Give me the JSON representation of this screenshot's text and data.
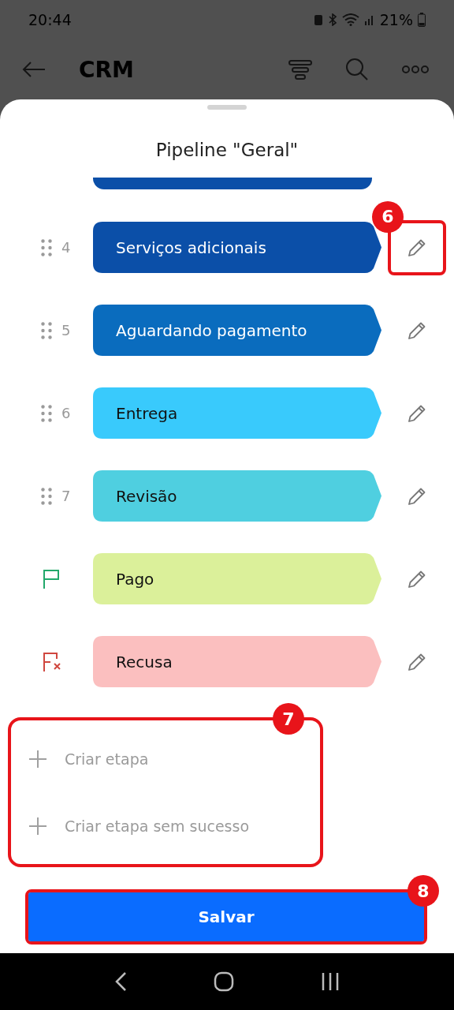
{
  "status_bar": {
    "time": "20:44",
    "battery": "21%"
  },
  "app_bar": {
    "title": "CRM"
  },
  "sheet": {
    "title": "Pipeline \"Geral\"",
    "partial_stage": {
      "color": "#0b4fa8"
    },
    "stages": [
      {
        "kind": "numbered",
        "number": "4",
        "label": "Serviços adicionais",
        "color": "#0b4fa8",
        "callout": "6"
      },
      {
        "kind": "numbered",
        "number": "5",
        "label": "Aguardando pagamento",
        "color": "#0a6cbe"
      },
      {
        "kind": "numbered",
        "number": "6",
        "label": "Entrega",
        "color": "#39cafc"
      },
      {
        "kind": "numbered",
        "number": "7",
        "label": "Revisão",
        "color": "#4fcfe0"
      },
      {
        "kind": "success",
        "label": "Pago",
        "color": "#dbf09a"
      },
      {
        "kind": "failure",
        "label": "Recusa",
        "color": "#fbbfbf"
      }
    ],
    "add_actions": {
      "callout": "7",
      "items": [
        {
          "label": "Criar etapa"
        },
        {
          "label": "Criar etapa sem sucesso"
        }
      ]
    },
    "save_button": {
      "label": "Salvar",
      "callout": "8"
    }
  }
}
